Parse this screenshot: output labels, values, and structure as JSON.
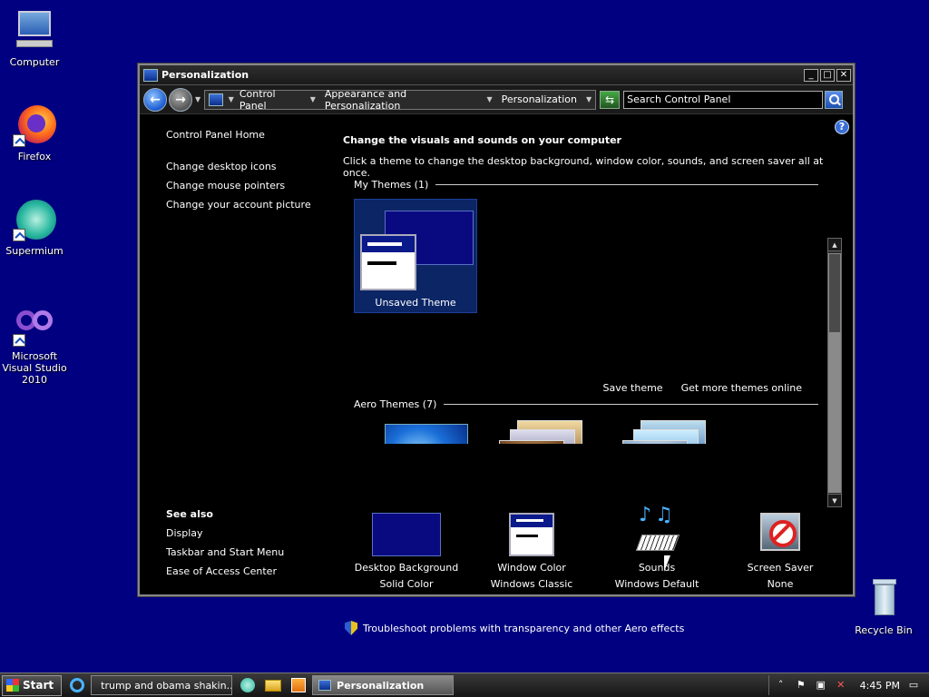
{
  "desktop": {
    "icons": [
      {
        "label": "Computer"
      },
      {
        "label": "Firefox"
      },
      {
        "label": "Supermium"
      },
      {
        "label": "Microsoft Visual Studio 2010"
      },
      {
        "label": "Recycle Bin"
      }
    ]
  },
  "window": {
    "title": "Personalization",
    "controls": {
      "minimize": "_",
      "maximize": "□",
      "close": "✕"
    },
    "breadcrumbs": [
      "Control Panel",
      "Appearance and Personalization",
      "Personalization"
    ],
    "search": {
      "value": "Search Control Panel"
    },
    "help": "?"
  },
  "sidebar": {
    "home": "Control Panel Home",
    "links": [
      "Change desktop icons",
      "Change mouse pointers",
      "Change your account picture"
    ],
    "see_also_heading": "See also",
    "see_also": [
      "Display",
      "Taskbar and Start Menu",
      "Ease of Access Center"
    ]
  },
  "main": {
    "heading": "Change the visuals and sounds on your computer",
    "description": "Click a theme to change the desktop background, window color, sounds, and screen saver all at once.",
    "my_themes_label": "My Themes (1)",
    "unsaved_theme": "Unsaved Theme",
    "save_theme": "Save theme",
    "get_more": "Get more themes online",
    "aero_themes_label": "Aero Themes (7)"
  },
  "settings": [
    {
      "title": "Desktop Background",
      "value": "Solid Color"
    },
    {
      "title": "Window Color",
      "value": "Windows Classic"
    },
    {
      "title": "Sounds",
      "value": "Windows Default"
    },
    {
      "title": "Screen Saver",
      "value": "None"
    }
  ],
  "troubleshoot": "Troubleshoot problems with transparency and other Aero effects",
  "taskbar": {
    "start": "Start",
    "tasks": [
      "trump and obama shakin...",
      "Personalization"
    ],
    "clock": "4:45 PM"
  },
  "colors": {
    "desktop": "#000080",
    "accent": "#0a1a8a"
  }
}
